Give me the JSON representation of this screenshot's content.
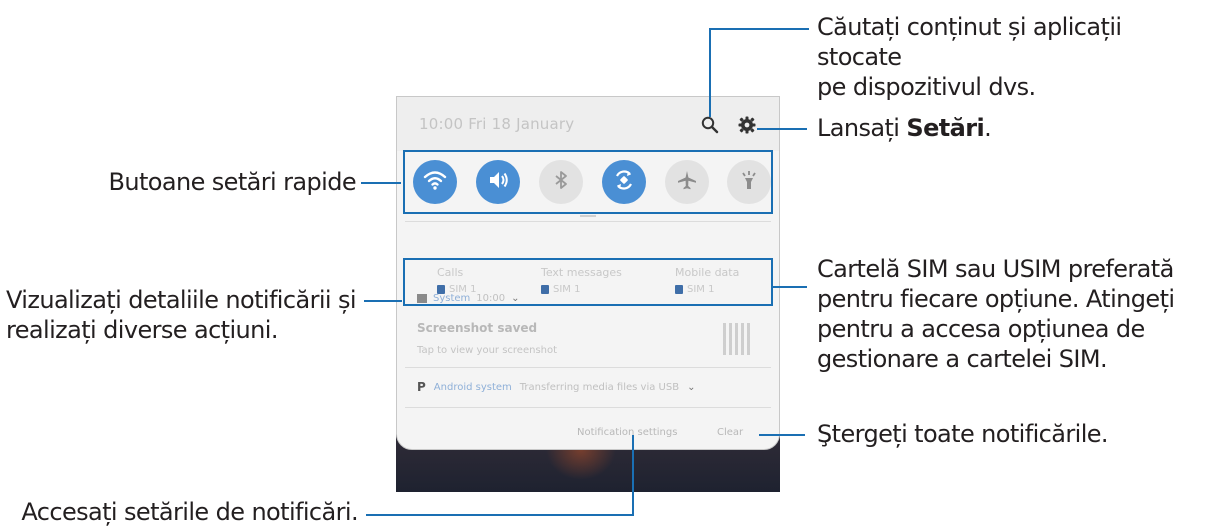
{
  "callouts": {
    "search_line1": "Căutați conținut și aplicații stocate",
    "search_line2": "pe dispozitivul dvs.",
    "settings_prefix": "Lansați ",
    "settings_bold": "Setări",
    "settings_suffix": ".",
    "quick_settings": "Butoane setări rapide",
    "sim_line1": "Cartelă SIM sau USIM preferată",
    "sim_line2": "pentru fiecare opțiune. Atingeți",
    "sim_line3": "pentru a accesa opțiunea de",
    "sim_line4": "gestionare a cartelei SIM.",
    "notif_details_line1": "Vizualizați detaliile notificării și",
    "notif_details_line2": "realizați diverse acțiuni.",
    "clear_all": "Ştergeți toate notificările.",
    "notif_settings": "Accesați setările de notificări."
  },
  "panel": {
    "datetime": "10:00  Fri 18 January",
    "quick_buttons": [
      {
        "name": "wifi",
        "state": "on"
      },
      {
        "name": "sound",
        "state": "on"
      },
      {
        "name": "bluetooth",
        "state": "off"
      },
      {
        "name": "auto-rotate",
        "state": "on"
      },
      {
        "name": "airplane-mode",
        "state": "off"
      },
      {
        "name": "flashlight",
        "state": "off"
      }
    ],
    "sim": [
      {
        "label": "Calls",
        "value": "SIM 1"
      },
      {
        "label": "Text messages",
        "value": "SIM 1"
      },
      {
        "label": "Mobile data",
        "value": "SIM 1"
      }
    ],
    "notification1": {
      "app": "System",
      "time": "10:00",
      "title": "Screenshot saved",
      "body": "Tap to view your screenshot"
    },
    "notification2": {
      "app": "Android system",
      "text": "Transferring media files via USB"
    },
    "footer": {
      "settings_label": "Notification settings",
      "clear_label": "Clear"
    }
  },
  "colors": {
    "accent_line": "#1a6fb3",
    "toggle_on": "#4a8fd4",
    "toggle_off": "#e2e2e2"
  }
}
